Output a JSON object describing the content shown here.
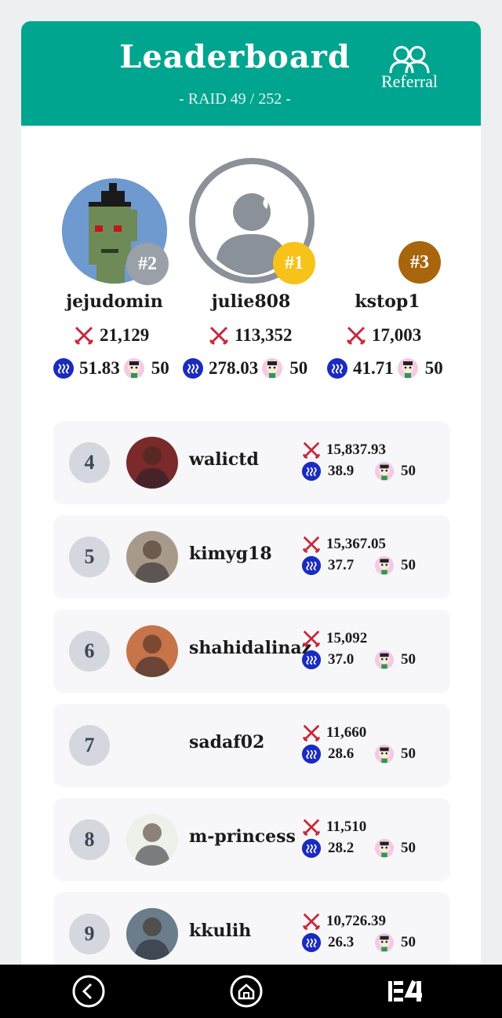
{
  "header": {
    "title": "Leaderboard",
    "subtitle": "- RAID 49 / 252 -",
    "referral_label": "Referral",
    "bg_color": "#00a58f"
  },
  "podium": [
    {
      "place_badge": "#2",
      "name": "jejudomin",
      "damage": "21,129",
      "steem": "51.83",
      "monsters": "50",
      "badge_color": "#9aa0a8"
    },
    {
      "place_badge": "#1",
      "name": "julie808",
      "damage": "113,352",
      "steem": "278.03",
      "monsters": "50",
      "badge_color": "#f7c21a"
    },
    {
      "place_badge": "#3",
      "name": "kstop1",
      "damage": "17,003",
      "steem": "41.71",
      "monsters": "50",
      "badge_color": "#a8650b"
    }
  ],
  "rows": [
    {
      "rank": "4",
      "name": "walictd",
      "damage": "15,837.93",
      "steem": "38.9",
      "monsters": "50"
    },
    {
      "rank": "5",
      "name": "kimyg18",
      "damage": "15,367.05",
      "steem": "37.7",
      "monsters": "50"
    },
    {
      "rank": "6",
      "name": "shahidalinaz",
      "damage": "15,092",
      "steem": "37.0",
      "monsters": "50"
    },
    {
      "rank": "7",
      "name": "sadaf02",
      "damage": "11,660",
      "steem": "28.6",
      "monsters": "50"
    },
    {
      "rank": "8",
      "name": "m-princess",
      "damage": "11,510",
      "steem": "28.2",
      "monsters": "50"
    },
    {
      "rank": "9",
      "name": "kkulih",
      "damage": "10,726.39",
      "steem": "26.3",
      "monsters": "50"
    }
  ],
  "icons": {
    "damage": "crossed-swords-icon",
    "steem": "steem-coin-icon",
    "monster": "monster-face-icon"
  },
  "colors": {
    "accent": "#00a58f",
    "steem_blue": "#1a2bbf",
    "sword_red": "#c8283c"
  }
}
